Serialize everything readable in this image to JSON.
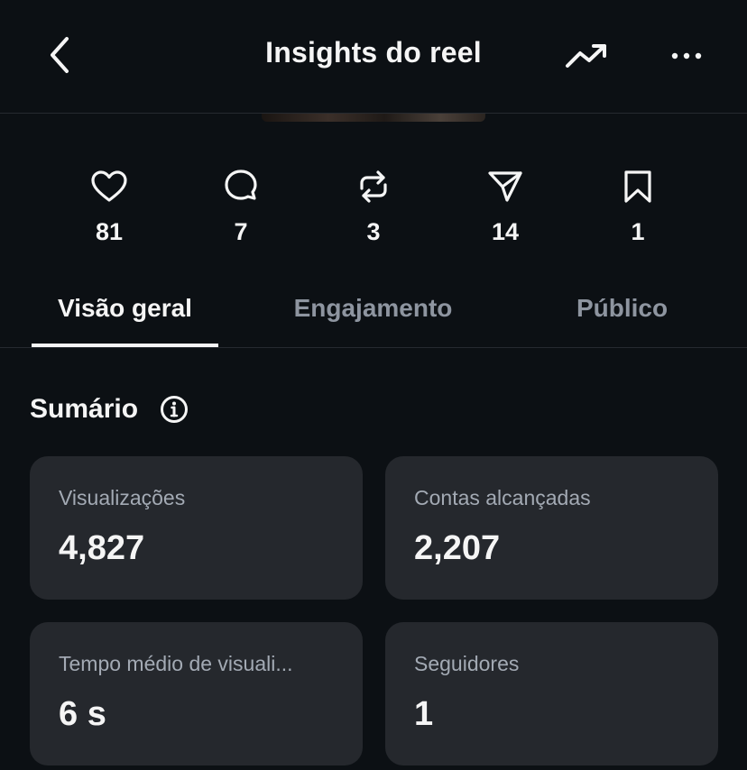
{
  "header": {
    "title": "Insights do reel"
  },
  "metrics": [
    {
      "icon": "heart-icon",
      "count": "81"
    },
    {
      "icon": "comment-icon",
      "count": "7"
    },
    {
      "icon": "repost-icon",
      "count": "3"
    },
    {
      "icon": "share-icon",
      "count": "14"
    },
    {
      "icon": "bookmark-icon",
      "count": "1"
    }
  ],
  "tabs": [
    {
      "label": "Visão geral",
      "active": true
    },
    {
      "label": "Engajamento",
      "active": false
    },
    {
      "label": "Público",
      "active": false
    }
  ],
  "summary": {
    "title": "Sumário",
    "cards": [
      {
        "label": "Visualizações",
        "value": "4,827"
      },
      {
        "label": "Contas alcançadas",
        "value": "2,207"
      },
      {
        "label": "Tempo médio de visuali...",
        "value": "6 s"
      },
      {
        "label": "Seguidores",
        "value": "1"
      }
    ]
  },
  "colors": {
    "background": "#0c1014",
    "card": "#25282d",
    "text": "#f5f5f5",
    "muted": "#8e95a0"
  }
}
